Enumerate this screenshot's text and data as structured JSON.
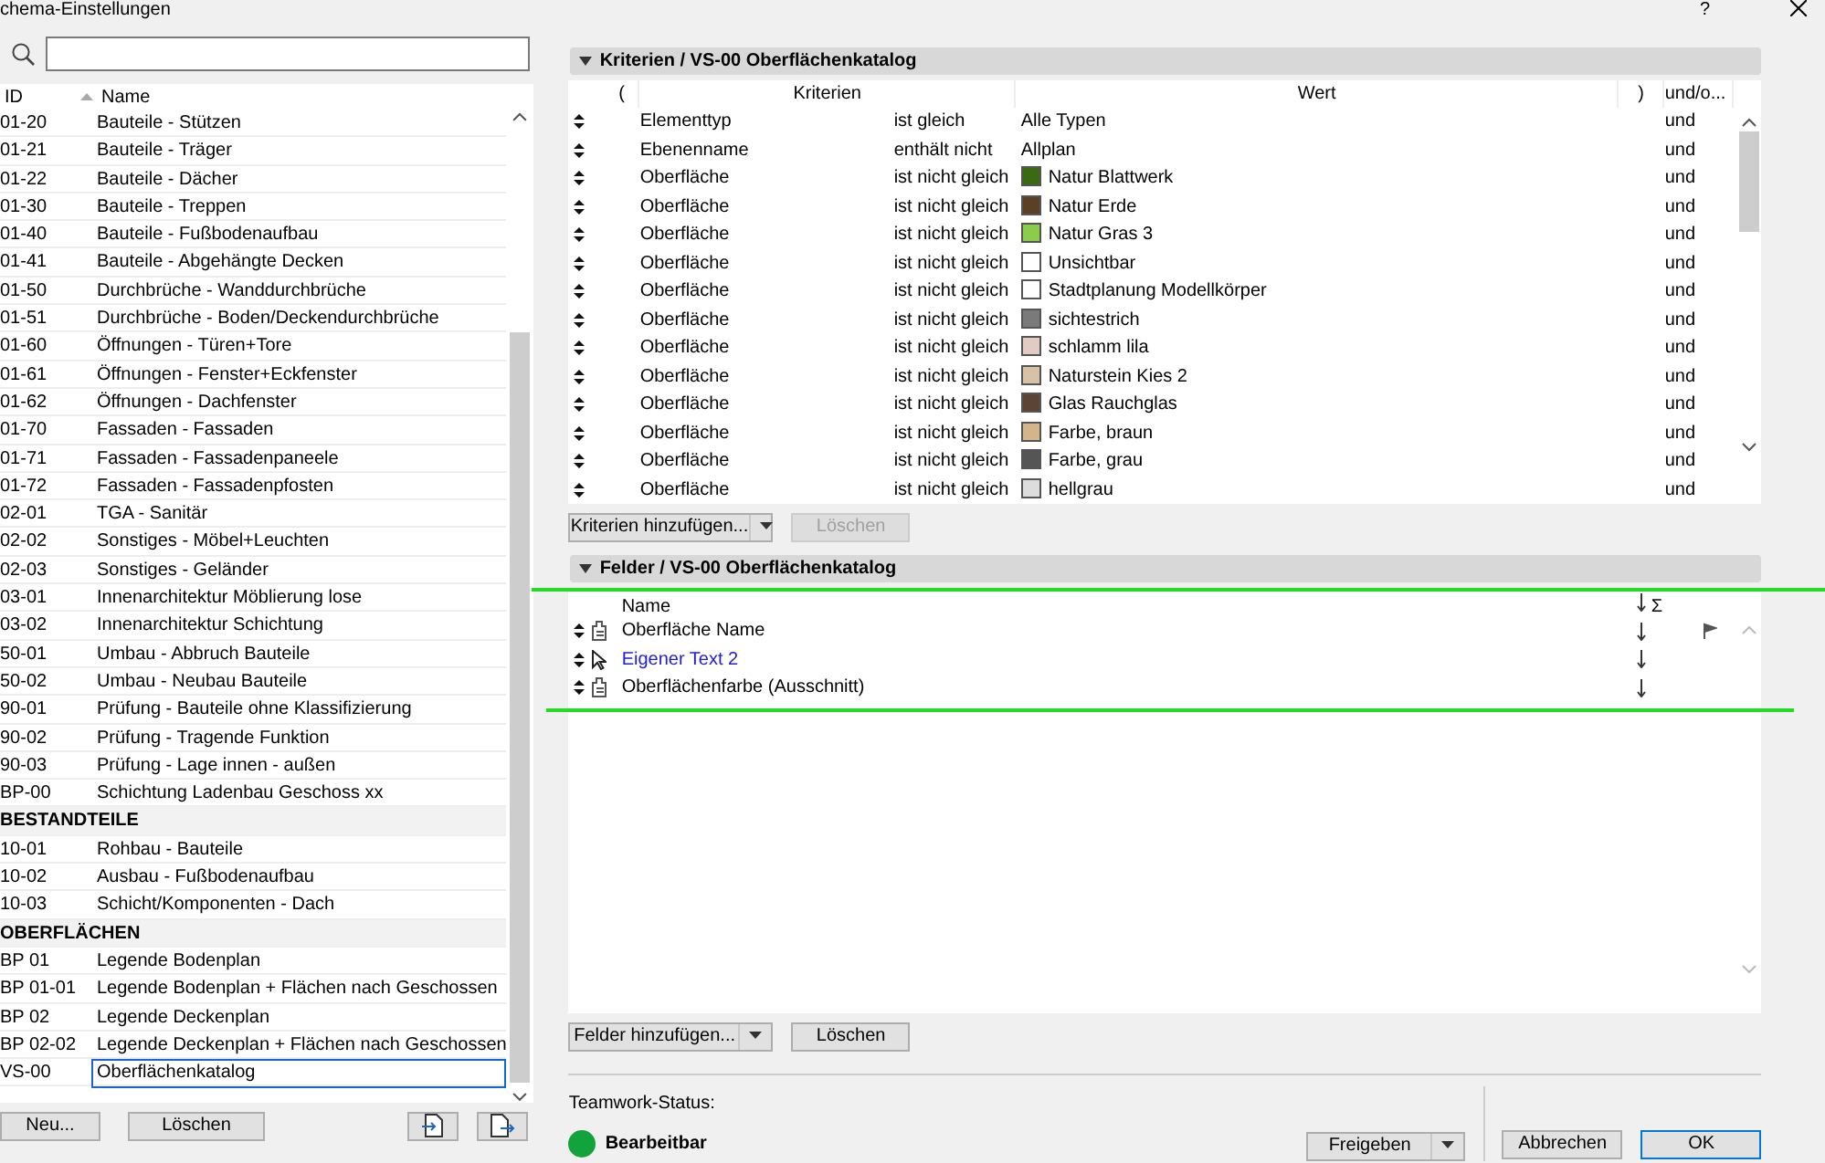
{
  "window": {
    "title": "chema-Einstellungen",
    "help": "?"
  },
  "list": {
    "columns": [
      "ID",
      "Name"
    ],
    "rows": [
      {
        "kind": "item",
        "id": "01-20",
        "name": "Bauteile - Stützen",
        "selected": false
      },
      {
        "kind": "item",
        "id": "01-21",
        "name": "Bauteile - Träger",
        "selected": false
      },
      {
        "kind": "item",
        "id": "01-22",
        "name": "Bauteile - Dächer",
        "selected": false
      },
      {
        "kind": "item",
        "id": "01-30",
        "name": "Bauteile - Treppen",
        "selected": false
      },
      {
        "kind": "item",
        "id": "01-40",
        "name": "Bauteile - Fußbodenaufbau",
        "selected": false
      },
      {
        "kind": "item",
        "id": "01-41",
        "name": "Bauteile - Abgehängte Decken",
        "selected": false
      },
      {
        "kind": "item",
        "id": "01-50",
        "name": "Durchbrüche - Wanddurchbrüche",
        "selected": false
      },
      {
        "kind": "item",
        "id": "01-51",
        "name": "Durchbrüche - Boden/Deckendurchbrüche",
        "selected": false
      },
      {
        "kind": "item",
        "id": "01-60",
        "name": "Öffnungen - Türen+Tore",
        "selected": false
      },
      {
        "kind": "item",
        "id": "01-61",
        "name": "Öffnungen - Fenster+Eckfenster",
        "selected": false
      },
      {
        "kind": "item",
        "id": "01-62",
        "name": "Öffnungen - Dachfenster",
        "selected": false
      },
      {
        "kind": "item",
        "id": "01-70",
        "name": "Fassaden - Fassaden",
        "selected": false
      },
      {
        "kind": "item",
        "id": "01-71",
        "name": "Fassaden - Fassadenpaneele",
        "selected": false
      },
      {
        "kind": "item",
        "id": "01-72",
        "name": "Fassaden - Fassadenpfosten",
        "selected": false
      },
      {
        "kind": "item",
        "id": "02-01",
        "name": "TGA - Sanitär",
        "selected": false
      },
      {
        "kind": "item",
        "id": "02-02",
        "name": "Sonstiges - Möbel+Leuchten",
        "selected": false
      },
      {
        "kind": "item",
        "id": "02-03",
        "name": "Sonstiges - Geländer",
        "selected": false
      },
      {
        "kind": "item",
        "id": "03-01",
        "name": "Innenarchitektur Möblierung lose",
        "selected": false
      },
      {
        "kind": "item",
        "id": "03-02",
        "name": "Innenarchitektur Schichtung",
        "selected": false
      },
      {
        "kind": "item",
        "id": "50-01",
        "name": "Umbau - Abbruch Bauteile",
        "selected": false
      },
      {
        "kind": "item",
        "id": "50-02",
        "name": "Umbau - Neubau Bauteile",
        "selected": false
      },
      {
        "kind": "item",
        "id": "90-01",
        "name": "Prüfung - Bauteile ohne Klassifizierung",
        "selected": false
      },
      {
        "kind": "item",
        "id": "90-02",
        "name": "Prüfung - Tragende Funktion",
        "selected": false
      },
      {
        "kind": "item",
        "id": "90-03",
        "name": "Prüfung - Lage innen - außen",
        "selected": false
      },
      {
        "kind": "item",
        "id": "BP-00",
        "name": "Schichtung Ladenbau Geschoss xx",
        "selected": false
      },
      {
        "kind": "group",
        "name": "BESTANDTEILE"
      },
      {
        "kind": "item",
        "id": "10-01",
        "name": "Rohbau - Bauteile",
        "selected": false
      },
      {
        "kind": "item",
        "id": "10-02",
        "name": "Ausbau - Fußbodenaufbau",
        "selected": false
      },
      {
        "kind": "item",
        "id": "10-03",
        "name": "Schicht/Komponenten - Dach",
        "selected": false
      },
      {
        "kind": "group",
        "name": "OBERFLÄCHEN"
      },
      {
        "kind": "item",
        "id": "BP 01",
        "name": "Legende Bodenplan",
        "selected": false
      },
      {
        "kind": "item",
        "id": "BP 01-01",
        "name": "Legende Bodenplan + Flächen nach Geschossen",
        "selected": false
      },
      {
        "kind": "item",
        "id": "BP 02",
        "name": "Legende Deckenplan",
        "selected": false
      },
      {
        "kind": "item",
        "id": "BP 02-02",
        "name": "Legende Deckenplan + Flächen nach Geschossen",
        "selected": false
      },
      {
        "kind": "item",
        "id": "VS-00",
        "name": "Oberflächenkatalog",
        "selected": true
      }
    ],
    "buttons": [
      "Neu...",
      "Löschen"
    ]
  },
  "criteria": {
    "title": "Kriterien / VS-00 Oberflächenkatalog",
    "columns": [
      "(",
      "Kriterien",
      "Wert",
      ")",
      "und/o..."
    ],
    "rows": [
      {
        "property": "Elementtyp",
        "operator": "ist gleich",
        "value": "Alle Typen",
        "logic": "und"
      },
      {
        "property": "Ebenenname",
        "operator": "enthält nicht",
        "value": "Allplan",
        "logic": "und"
      },
      {
        "property": "Oberfläche",
        "operator": "ist nicht gleich",
        "value": "Natur Blattwerk",
        "color": "#3a6b10",
        "logic": "und"
      },
      {
        "property": "Oberfläche",
        "operator": "ist nicht gleich",
        "value": "Natur Erde",
        "color": "#5a4024",
        "logic": "und"
      },
      {
        "property": "Oberfläche",
        "operator": "ist nicht gleich",
        "value": "Natur Gras 3",
        "color": "#8ccc4c",
        "logic": "und"
      },
      {
        "property": "Oberfläche",
        "operator": "ist nicht gleich",
        "value": "Unsichtbar",
        "color": "#ffffff",
        "logic": "und"
      },
      {
        "property": "Oberfläche",
        "operator": "ist nicht gleich",
        "value": "Stadtplanung Modellkörper",
        "color": "#ffffff",
        "logic": "und"
      },
      {
        "property": "Oberfläche",
        "operator": "ist nicht gleich",
        "value": "sichtestrich",
        "color": "#7a7a7a",
        "logic": "und"
      },
      {
        "property": "Oberfläche",
        "operator": "ist nicht gleich",
        "value": "schlamm lila",
        "color": "#e2cbc2",
        "logic": "und"
      },
      {
        "property": "Oberfläche",
        "operator": "ist nicht gleich",
        "value": "Naturstein Kies 2",
        "color": "#d8c2a6",
        "logic": "und"
      },
      {
        "property": "Oberfläche",
        "operator": "ist nicht gleich",
        "value": "Glas Rauchglas",
        "color": "#5c4434",
        "logic": "und"
      },
      {
        "property": "Oberfläche",
        "operator": "ist nicht gleich",
        "value": "Farbe, braun",
        "color": "#d4b48a",
        "logic": "und"
      },
      {
        "property": "Oberfläche",
        "operator": "ist nicht gleich",
        "value": "Farbe, grau",
        "color": "#555555",
        "logic": "und"
      },
      {
        "property": "Oberfläche",
        "operator": "ist nicht gleich",
        "value": "hellgrau",
        "color": "#dddddd",
        "logic": "und"
      }
    ],
    "add_button": "Kriterien hinzufügen...",
    "delete_button": "Löschen",
    "delete_disabled": true
  },
  "fields": {
    "title": "Felder / VS-00 Oberflächenkatalog",
    "columns": [
      "Name",
      "Σ"
    ],
    "rows": [
      {
        "kind": "property",
        "name": "Oberfläche Name",
        "flag": true
      },
      {
        "kind": "custom",
        "name": "Eigener Text  2",
        "flag": false
      },
      {
        "kind": "property",
        "name": "Oberflächenfarbe (Ausschnitt)",
        "flag": false
      }
    ],
    "add_button": "Felder hinzufügen...",
    "delete_button": "Löschen",
    "delete_disabled": false
  },
  "teamwork": {
    "label": "Teamwork-Status:",
    "status": "Bearbeitbar",
    "color": "#12a33a",
    "share_button": "Freigeben"
  },
  "dialog_buttons": [
    "Abbrechen",
    "OK"
  ]
}
